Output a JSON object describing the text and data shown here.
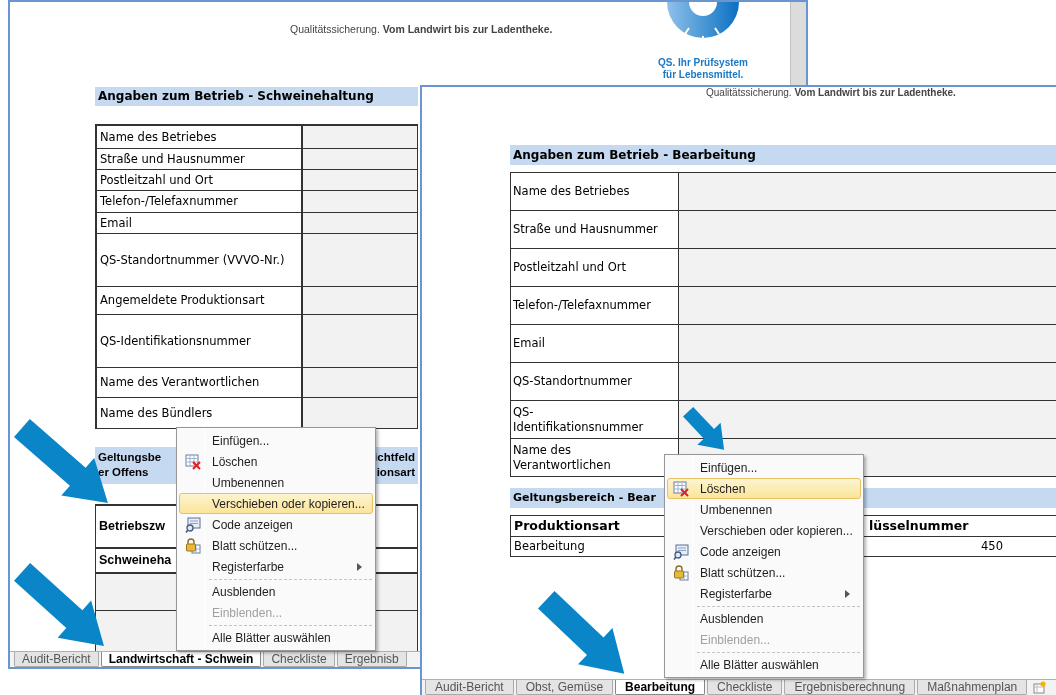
{
  "back_window": {
    "slogan": "Qualitätssicherung. **Vom Landwirt bis zur Ladentheke.**",
    "logo_lines": [
      "QS. Ihr Prüfsystem",
      "für Lebensmittel."
    ],
    "section_title": "Angaben zum Betrieb - Schweinehaltung",
    "fields": [
      {
        "label": "Name des Betriebes"
      },
      {
        "label": "Straße und Hausnummer"
      },
      {
        "label": "Postleitzahl und Ort"
      },
      {
        "label": "Telefon-/Telefaxnummer"
      },
      {
        "label": "Email"
      },
      {
        "label": "QS-Standortnummer (VVVO-Nr.)"
      },
      {
        "label": "Angemeldete Produktionsart"
      },
      {
        "label": "QS-Identifikationsnummer"
      },
      {
        "label": "Name des Verantwortlichen"
      },
      {
        "label": "Name des Bündlers"
      }
    ],
    "scope_band": {
      "left_lines": [
        "Geltungsbe",
        "er Offens"
      ],
      "right_lines": [
        "ichtfeld",
        "ionsart"
      ]
    },
    "scope_rows": [
      "Betriebszw",
      "Schweineha"
    ],
    "context_menu": {
      "items": [
        {
          "kind": "command",
          "label": "Einfügen...",
          "selected": false,
          "disabled": false
        },
        {
          "kind": "delete",
          "label": "Löschen",
          "selected": false,
          "disabled": false
        },
        {
          "kind": "command",
          "label": "Umbenennen",
          "selected": false,
          "disabled": false
        },
        {
          "kind": "command",
          "label": "Verschieben oder kopieren...",
          "selected": true,
          "disabled": false
        },
        {
          "kind": "code",
          "label": "Code anzeigen",
          "selected": false,
          "disabled": false
        },
        {
          "kind": "protect",
          "label": "Blatt schützen...",
          "selected": false,
          "disabled": false
        },
        {
          "kind": "submenu",
          "label": "Registerfarbe",
          "selected": false,
          "disabled": false
        },
        {
          "kind": "separator"
        },
        {
          "kind": "command",
          "label": "Ausblenden",
          "selected": false,
          "disabled": false
        },
        {
          "kind": "command",
          "label": "Einblenden...",
          "selected": false,
          "disabled": true
        },
        {
          "kind": "separator"
        },
        {
          "kind": "command",
          "label": "Alle Blätter auswählen",
          "selected": false,
          "disabled": false
        }
      ]
    },
    "sheet_tabs": [
      {
        "label": "Audit-Bericht",
        "selected": false
      },
      {
        "label": "Landwirtschaft - Schwein",
        "selected": true
      },
      {
        "label": "Checkliste",
        "selected": false
      },
      {
        "label": "Ergebnisb",
        "selected": false
      }
    ]
  },
  "front_window": {
    "slogan": "Qualitätssicherung. **Vom Landwirt bis zur Ladentheke.**",
    "section_title": "Angaben zum Betrieb - Bearbeitung",
    "fields": [
      {
        "label": "Name des Betriebes"
      },
      {
        "label": "Straße und Hausnummer"
      },
      {
        "label": "Postleitzahl und Ort"
      },
      {
        "label": "Telefon-/Telefaxnummer"
      },
      {
        "label": "Email"
      },
      {
        "label": "QS-Standortnummer"
      },
      {
        "label": "QS-Identifikationsnummer"
      },
      {
        "label": "Name des Verantwortlichen"
      }
    ],
    "scope_title": "Geltungsbereich - Bear",
    "scope_table": {
      "columns": [
        "Produktionsart",
        "lüsselnummer"
      ],
      "rows": [
        [
          "Bearbeitung",
          "450"
        ]
      ]
    },
    "context_menu": {
      "items": [
        {
          "kind": "command",
          "label": "Einfügen...",
          "selected": false,
          "disabled": false
        },
        {
          "kind": "delete",
          "label": "Löschen",
          "selected": true,
          "disabled": false
        },
        {
          "kind": "command",
          "label": "Umbenennen",
          "selected": false,
          "disabled": false
        },
        {
          "kind": "command",
          "label": "Verschieben oder kopieren...",
          "selected": false,
          "disabled": false
        },
        {
          "kind": "code",
          "label": "Code anzeigen",
          "selected": false,
          "disabled": false
        },
        {
          "kind": "protect",
          "label": "Blatt schützen...",
          "selected": false,
          "disabled": false
        },
        {
          "kind": "submenu",
          "label": "Registerfarbe",
          "selected": false,
          "disabled": false
        },
        {
          "kind": "separator"
        },
        {
          "kind": "command",
          "label": "Ausblenden",
          "selected": false,
          "disabled": false
        },
        {
          "kind": "command",
          "label": "Einblenden...",
          "selected": false,
          "disabled": true
        },
        {
          "kind": "separator"
        },
        {
          "kind": "command",
          "label": "Alle Blätter auswählen",
          "selected": false,
          "disabled": false
        }
      ]
    },
    "sheet_tabs": [
      {
        "label": "Audit-Bericht",
        "selected": false
      },
      {
        "label": "Obst, Gemüse",
        "selected": false
      },
      {
        "label": "Bearbeitung",
        "selected": true
      },
      {
        "label": "Checkliste",
        "selected": false
      },
      {
        "label": "Ergebnisberechnung",
        "selected": false
      },
      {
        "label": "Maßnahmenplan",
        "selected": false
      }
    ]
  }
}
